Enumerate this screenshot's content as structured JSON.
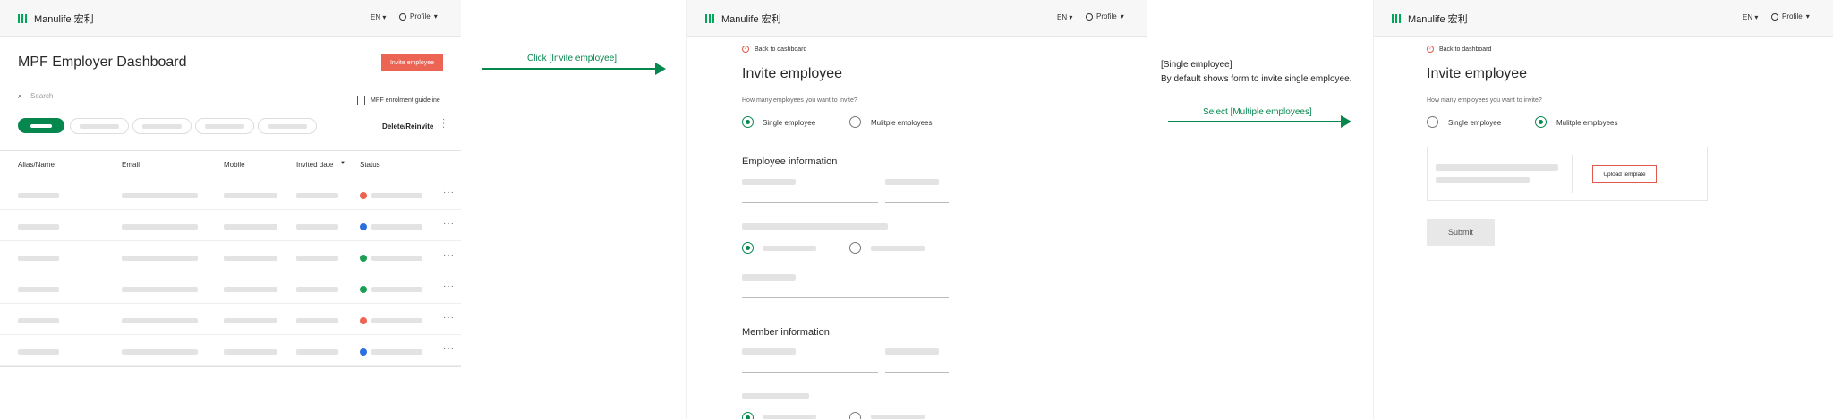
{
  "colors": {
    "brand": "#00a758",
    "accent_green": "#06874e",
    "invite_button": "#ec6453",
    "status_orange": "#ec6453",
    "status_blue": "#2e6fe0",
    "status_green": "#1e9e55",
    "upload_border": "#e05a4b"
  },
  "header": {
    "brand": "Manulife 宏利",
    "language": "EN",
    "profile": "Profile"
  },
  "dashboard": {
    "title": "MPF Employer Dashboard",
    "invite_button": "Invite employee",
    "search_placeholder": "Search",
    "guideline_link": "MPF enrolment guideline",
    "delete_reinvite": "Delete/Reinvite",
    "columns": {
      "name": "Alias/Name",
      "email": "Email",
      "mobile": "Mobile",
      "invited_date": "Invited date",
      "status": "Status"
    },
    "rows": [
      {
        "status": "orange"
      },
      {
        "status": "blue"
      },
      {
        "status": "green"
      },
      {
        "status": "green"
      },
      {
        "status": "orange"
      },
      {
        "status": "blue"
      }
    ]
  },
  "annotations": {
    "click_invite": "Click [Invite employee]",
    "single_title": "[Single employee]",
    "single_desc": "By default shows form to invite single employee.",
    "select_multiple": "Select [Multiple employees]"
  },
  "invite_single": {
    "back": "Back to dashboard",
    "title": "Invite employee",
    "question": "How many employees you want to invite?",
    "option_single": "Single employee",
    "option_multiple": "Mulitple employees",
    "employee_section": "Employee information",
    "member_section": "Member information"
  },
  "invite_multiple": {
    "back": "Back to dashboard",
    "title": "Invite employee",
    "question": "How many employees you want to invite?",
    "option_single": "Single employee",
    "option_multiple": "Mulitple employees",
    "upload": "Upload template",
    "submit": "Submit"
  }
}
